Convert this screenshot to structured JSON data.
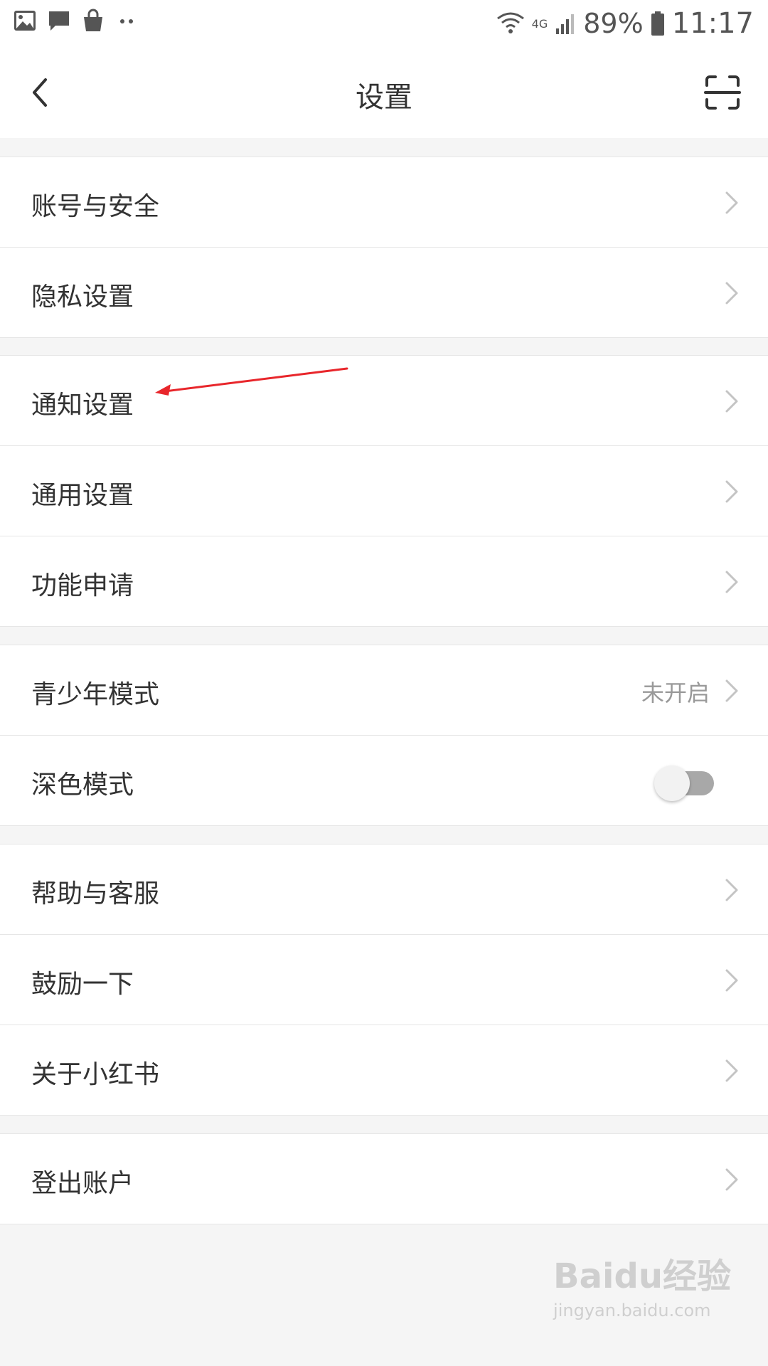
{
  "status_bar": {
    "battery": "89%",
    "time": "11:17",
    "network": "4G"
  },
  "header": {
    "title": "设置"
  },
  "groups": [
    {
      "items": [
        {
          "label": "账号与安全"
        },
        {
          "label": "隐私设置"
        }
      ]
    },
    {
      "items": [
        {
          "label": "通知设置"
        },
        {
          "label": "通用设置"
        },
        {
          "label": "功能申请"
        }
      ]
    },
    {
      "items": [
        {
          "label": "青少年模式",
          "value": "未开启"
        },
        {
          "label": "深色模式",
          "toggle": false
        }
      ]
    },
    {
      "items": [
        {
          "label": "帮助与客服"
        },
        {
          "label": "鼓励一下"
        },
        {
          "label": "关于小红书"
        }
      ]
    },
    {
      "items": [
        {
          "label": "登出账户"
        }
      ]
    }
  ],
  "watermark": {
    "logo": "Baidu经验",
    "url": "jingyan.baidu.com"
  },
  "colors": {
    "background": "#f5f5f5",
    "row_background": "#ffffff",
    "annotation_arrow": "#e8262b",
    "toggle_track_off": "#a8a8a8"
  }
}
